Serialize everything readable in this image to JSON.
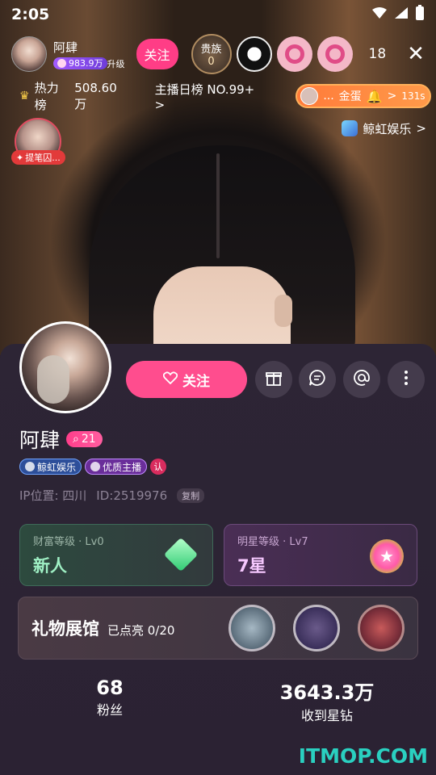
{
  "status_bar": {
    "time": "2:05"
  },
  "host": {
    "name": "阿肆",
    "level_text": "983.9万",
    "upgrade_label": "升级",
    "follow_label": "关注"
  },
  "noble": {
    "label": "贵族",
    "count": "0"
  },
  "viewer_count": "18",
  "rank": {
    "hot_label": "热力榜",
    "hot_value": "508.60万",
    "daily_label": "主播日榜",
    "daily_value": "NO.99+",
    "daily_arrow": ">"
  },
  "gift_banner": {
    "prefix": "...",
    "text": "金蛋",
    "arrow": ">",
    "timer": "131s"
  },
  "pk": {
    "label": "提笔囚..."
  },
  "guild_link": {
    "label": "鲸虹娱乐",
    "arrow": ">"
  },
  "profile": {
    "follow_label": "关注",
    "name": "阿肆",
    "fans_badge": "21",
    "tags": {
      "guild": "鲸虹娱乐",
      "quality": "优质主播",
      "verify": "认"
    },
    "ip_label": "IP位置: 四川",
    "id_label": "ID:2519976",
    "copy_label": "复制"
  },
  "wealth_card": {
    "caption": "财富等级 · Lv0",
    "value": "新人"
  },
  "star_card": {
    "caption": "明星等级 · Lv7",
    "value": "7星"
  },
  "gallery": {
    "title": "礼物展馆",
    "progress": "已点亮 0/20"
  },
  "stats": {
    "fans_value": "68",
    "fans_label": "粉丝",
    "diamonds_value": "3643.3万",
    "diamonds_label": "收到星钻"
  },
  "watermark": "ITMOP.COM",
  "colors": {
    "accent_pink": "#ff4d8e",
    "sheet_bg": "#2d2535",
    "watermark": "#2ad0c0"
  }
}
